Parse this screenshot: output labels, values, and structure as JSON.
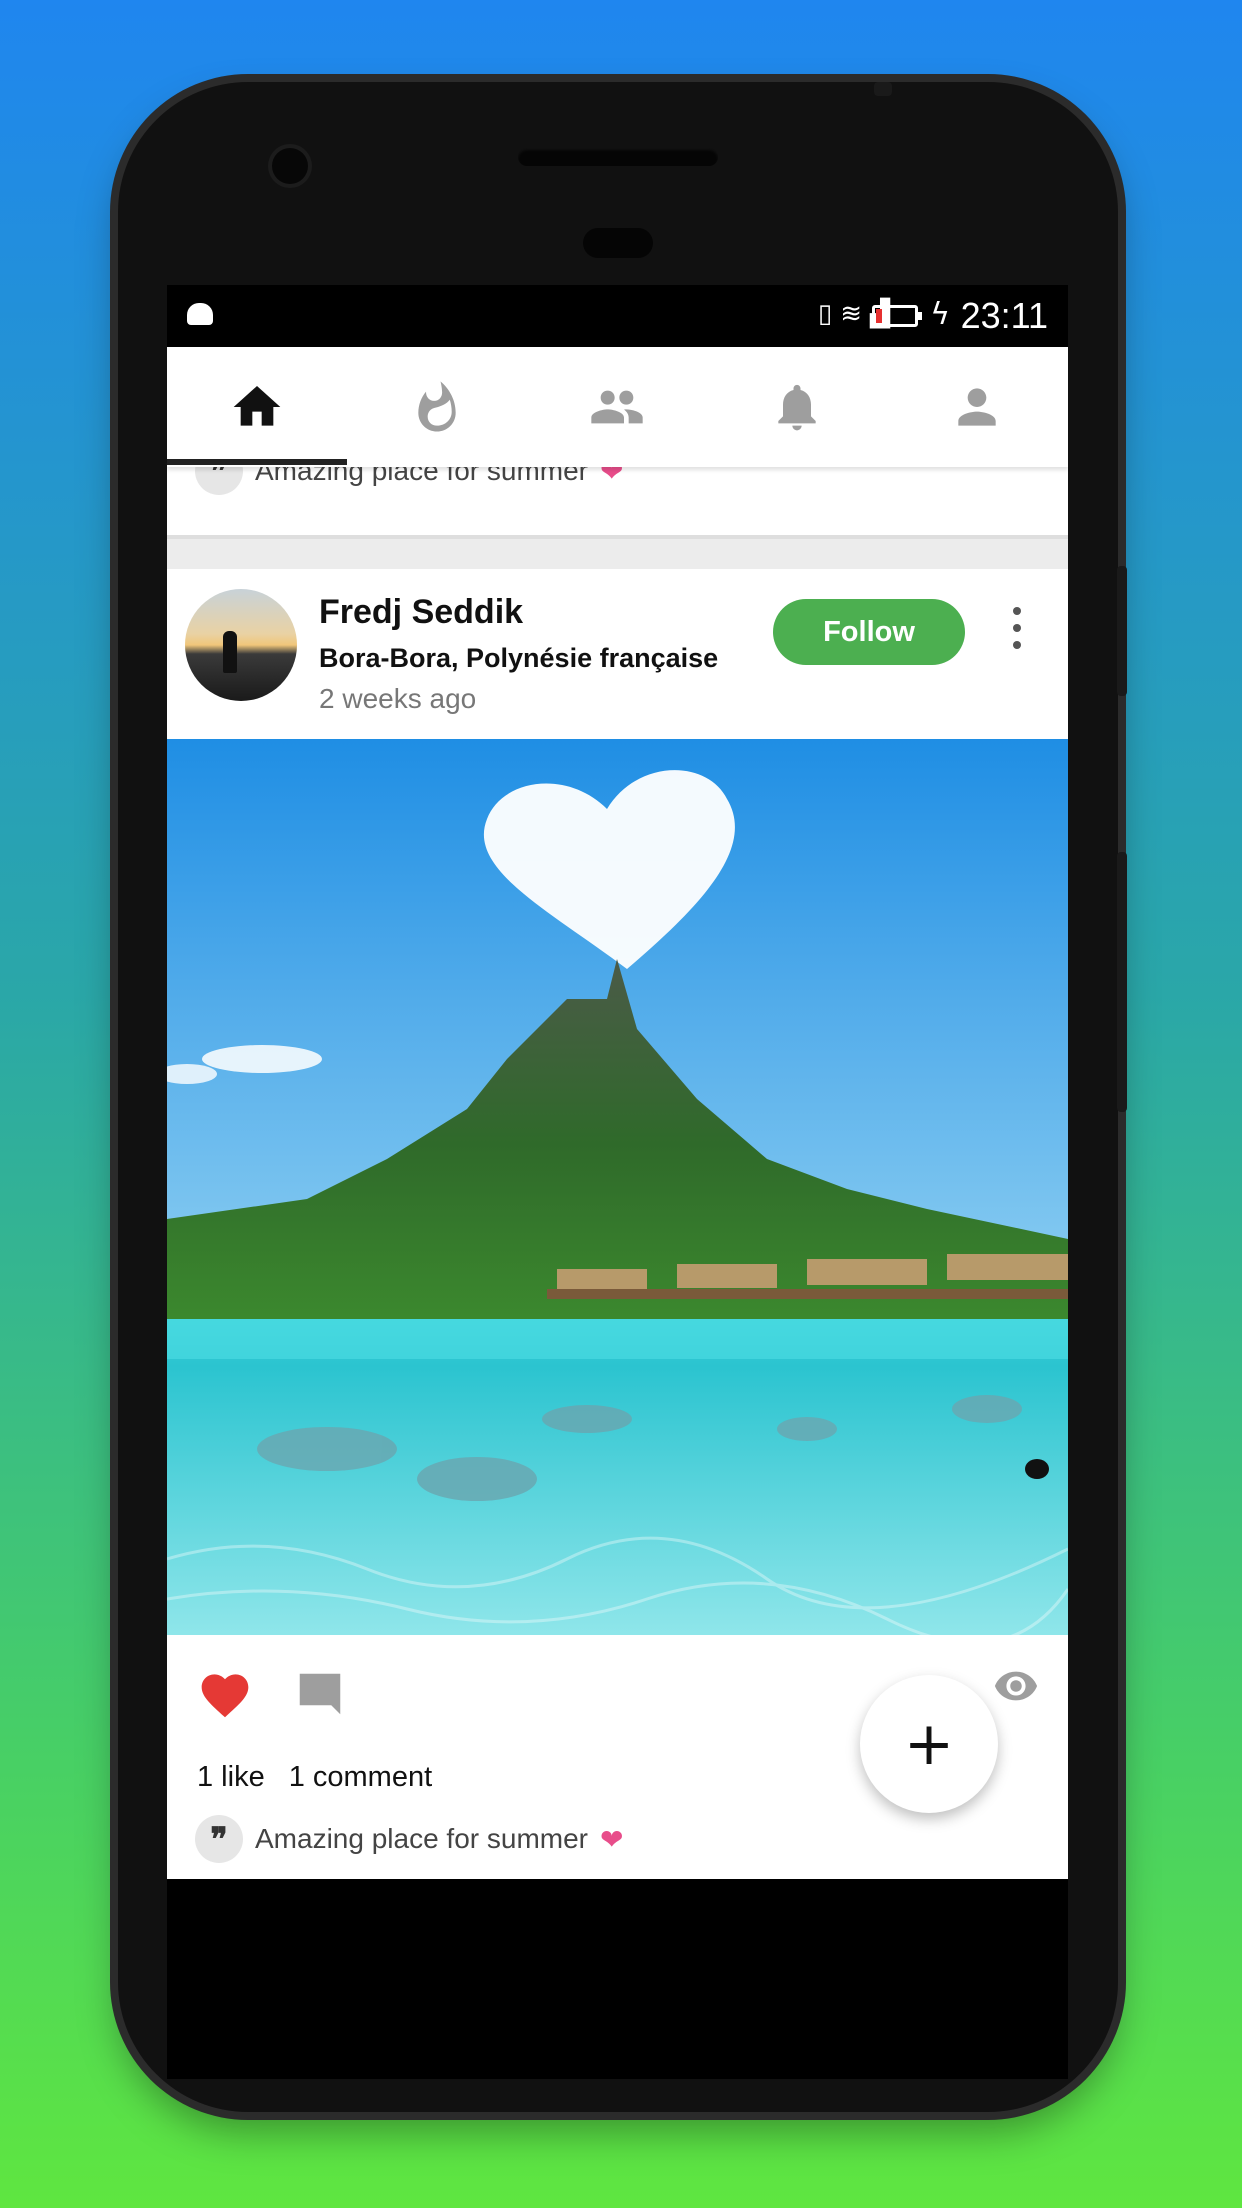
{
  "status_bar": {
    "time": "23:11",
    "icons": [
      "vibrate-icon",
      "wifi-icon",
      "signal-icon",
      "battery-icon",
      "charging-icon"
    ],
    "battery_level": 0.15,
    "battery_color": "#e63030"
  },
  "tabs": [
    {
      "name": "tab-home",
      "icon": "home-icon",
      "active": true
    },
    {
      "name": "tab-trending",
      "icon": "fire-icon",
      "active": false
    },
    {
      "name": "tab-friends",
      "icon": "people-icon",
      "active": false
    },
    {
      "name": "tab-notifications",
      "icon": "bell-icon",
      "active": false
    },
    {
      "name": "tab-profile",
      "icon": "person-icon",
      "active": false
    }
  ],
  "previous_post": {
    "caption": "Amazing place for summer",
    "caption_emoji": "❤"
  },
  "post": {
    "author": "Fredj  Seddik",
    "location": "Bora-Bora, Polynésie française",
    "time": "2 weeks ago",
    "follow_label": "Follow",
    "likes_label": "1 like",
    "comments_label": "1 comment",
    "caption": "Amazing place for summer",
    "caption_emoji": "❤",
    "liked": true,
    "quote_glyph": "❞"
  },
  "fab_label": "+",
  "colors": {
    "accent_green": "#4caf50",
    "like_red": "#e53935",
    "emoji_pink": "#e84d8a"
  }
}
